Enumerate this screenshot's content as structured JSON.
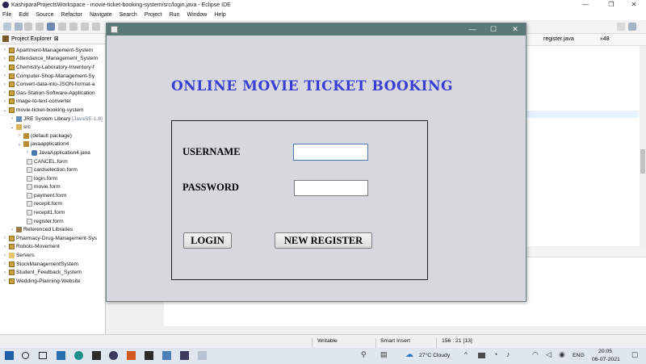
{
  "ide": {
    "window_title": "KashiparaProjectsWorkspace - movie-ticket-booking-system/src/login.java - Eclipse IDE",
    "menu": [
      "File",
      "Edit",
      "Source",
      "Refactor",
      "Navigate",
      "Search",
      "Project",
      "Run",
      "Window",
      "Help"
    ],
    "explorer_title": "Project Explorer",
    "explorer_close": "⊠",
    "tree": {
      "p1": "Apartment-Management-System",
      "p2": "Attendance_Management_System",
      "p3": "Chemistry-Laboratory-Inventory-f",
      "p4": "Computer-Shop-Management-Sy",
      "p5": "Convert-data-into-JSON-format-a",
      "p6": "Gas-Station-Software-Application",
      "p7": "image-to-text-converter",
      "p8": "movie-ticket-booking-system",
      "jre": "JRE System Library",
      "jre_ver": "[JavaSE-1.8]",
      "src": "src",
      "defpkg": "(default package)",
      "pkg": "javaapplication4",
      "javafile": "JavaApplication4.java",
      "f1": "CANCEL.form",
      "f2": "cardselection.form",
      "f3": "login.form",
      "f4": "movie.form",
      "f5": "payment.form",
      "f6": "recepit.form",
      "f7": "recepit1.form",
      "f8": "register.form",
      "reflib": "Referenced Libraries",
      "p9": "Pharmacy-Drug-Management-Sys",
      "p10": "Robots-Movement",
      "p11": "Servers",
      "p12": "StockManagementSystem",
      "p13": "Student_Feedback_System",
      "p14": "Wedding-Planning-Website"
    },
    "editor_tab": "register.java",
    "editor_tab_more": "»48",
    "status": {
      "writable": "Writable",
      "insert": "Smart Insert",
      "position": "156 : 21 [13]"
    }
  },
  "taskbar": {
    "weather": "27°C  Cloudy",
    "lang": "ENG",
    "time": "20:05",
    "date": "06-07-2021"
  },
  "dialog": {
    "heading": "ONLINE MOVIE TICKET BOOKING",
    "username_label": "USERNAME",
    "password_label": "PASSWORD",
    "username_value": "",
    "password_value": "",
    "login_button": "LOGIN",
    "register_button": "NEW REGISTER",
    "minimize": "—",
    "maximize": "☐",
    "close": "✕"
  },
  "colors": {
    "heading": "#3a3fd4",
    "dialog_bg": "#d6d8de",
    "dialog_title": "#5a7a78"
  }
}
